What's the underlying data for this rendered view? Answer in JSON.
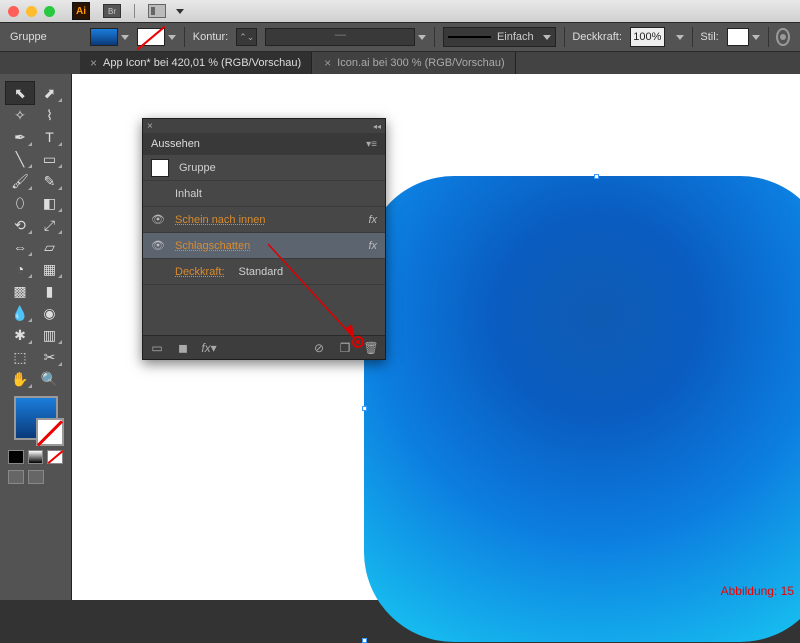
{
  "app": {
    "short": "Ai",
    "bridge": "Br"
  },
  "control_bar": {
    "selection_label": "Gruppe",
    "stroke_label": "Kontur:",
    "stroke_dash": "—",
    "stroke_style_label": "Einfach",
    "opacity_label": "Deckkraft:",
    "opacity_value": "100%",
    "style_label": "Stil:"
  },
  "tabs": [
    {
      "label": "App Icon* bei 420,01 % (RGB/Vorschau)",
      "active": true
    },
    {
      "label": "Icon.ai bei 300 % (RGB/Vorschau)",
      "active": false
    }
  ],
  "appearance": {
    "title": "Aussehen",
    "object_type": "Gruppe",
    "rows": {
      "contents": "Inhalt",
      "inner_glow": "Schein nach innen",
      "drop_shadow": "Schlagschatten",
      "opacity_label": "Deckkraft:",
      "opacity_value": "Standard"
    },
    "fx_label": "fx"
  },
  "figure_label": "Abbildung: 15"
}
